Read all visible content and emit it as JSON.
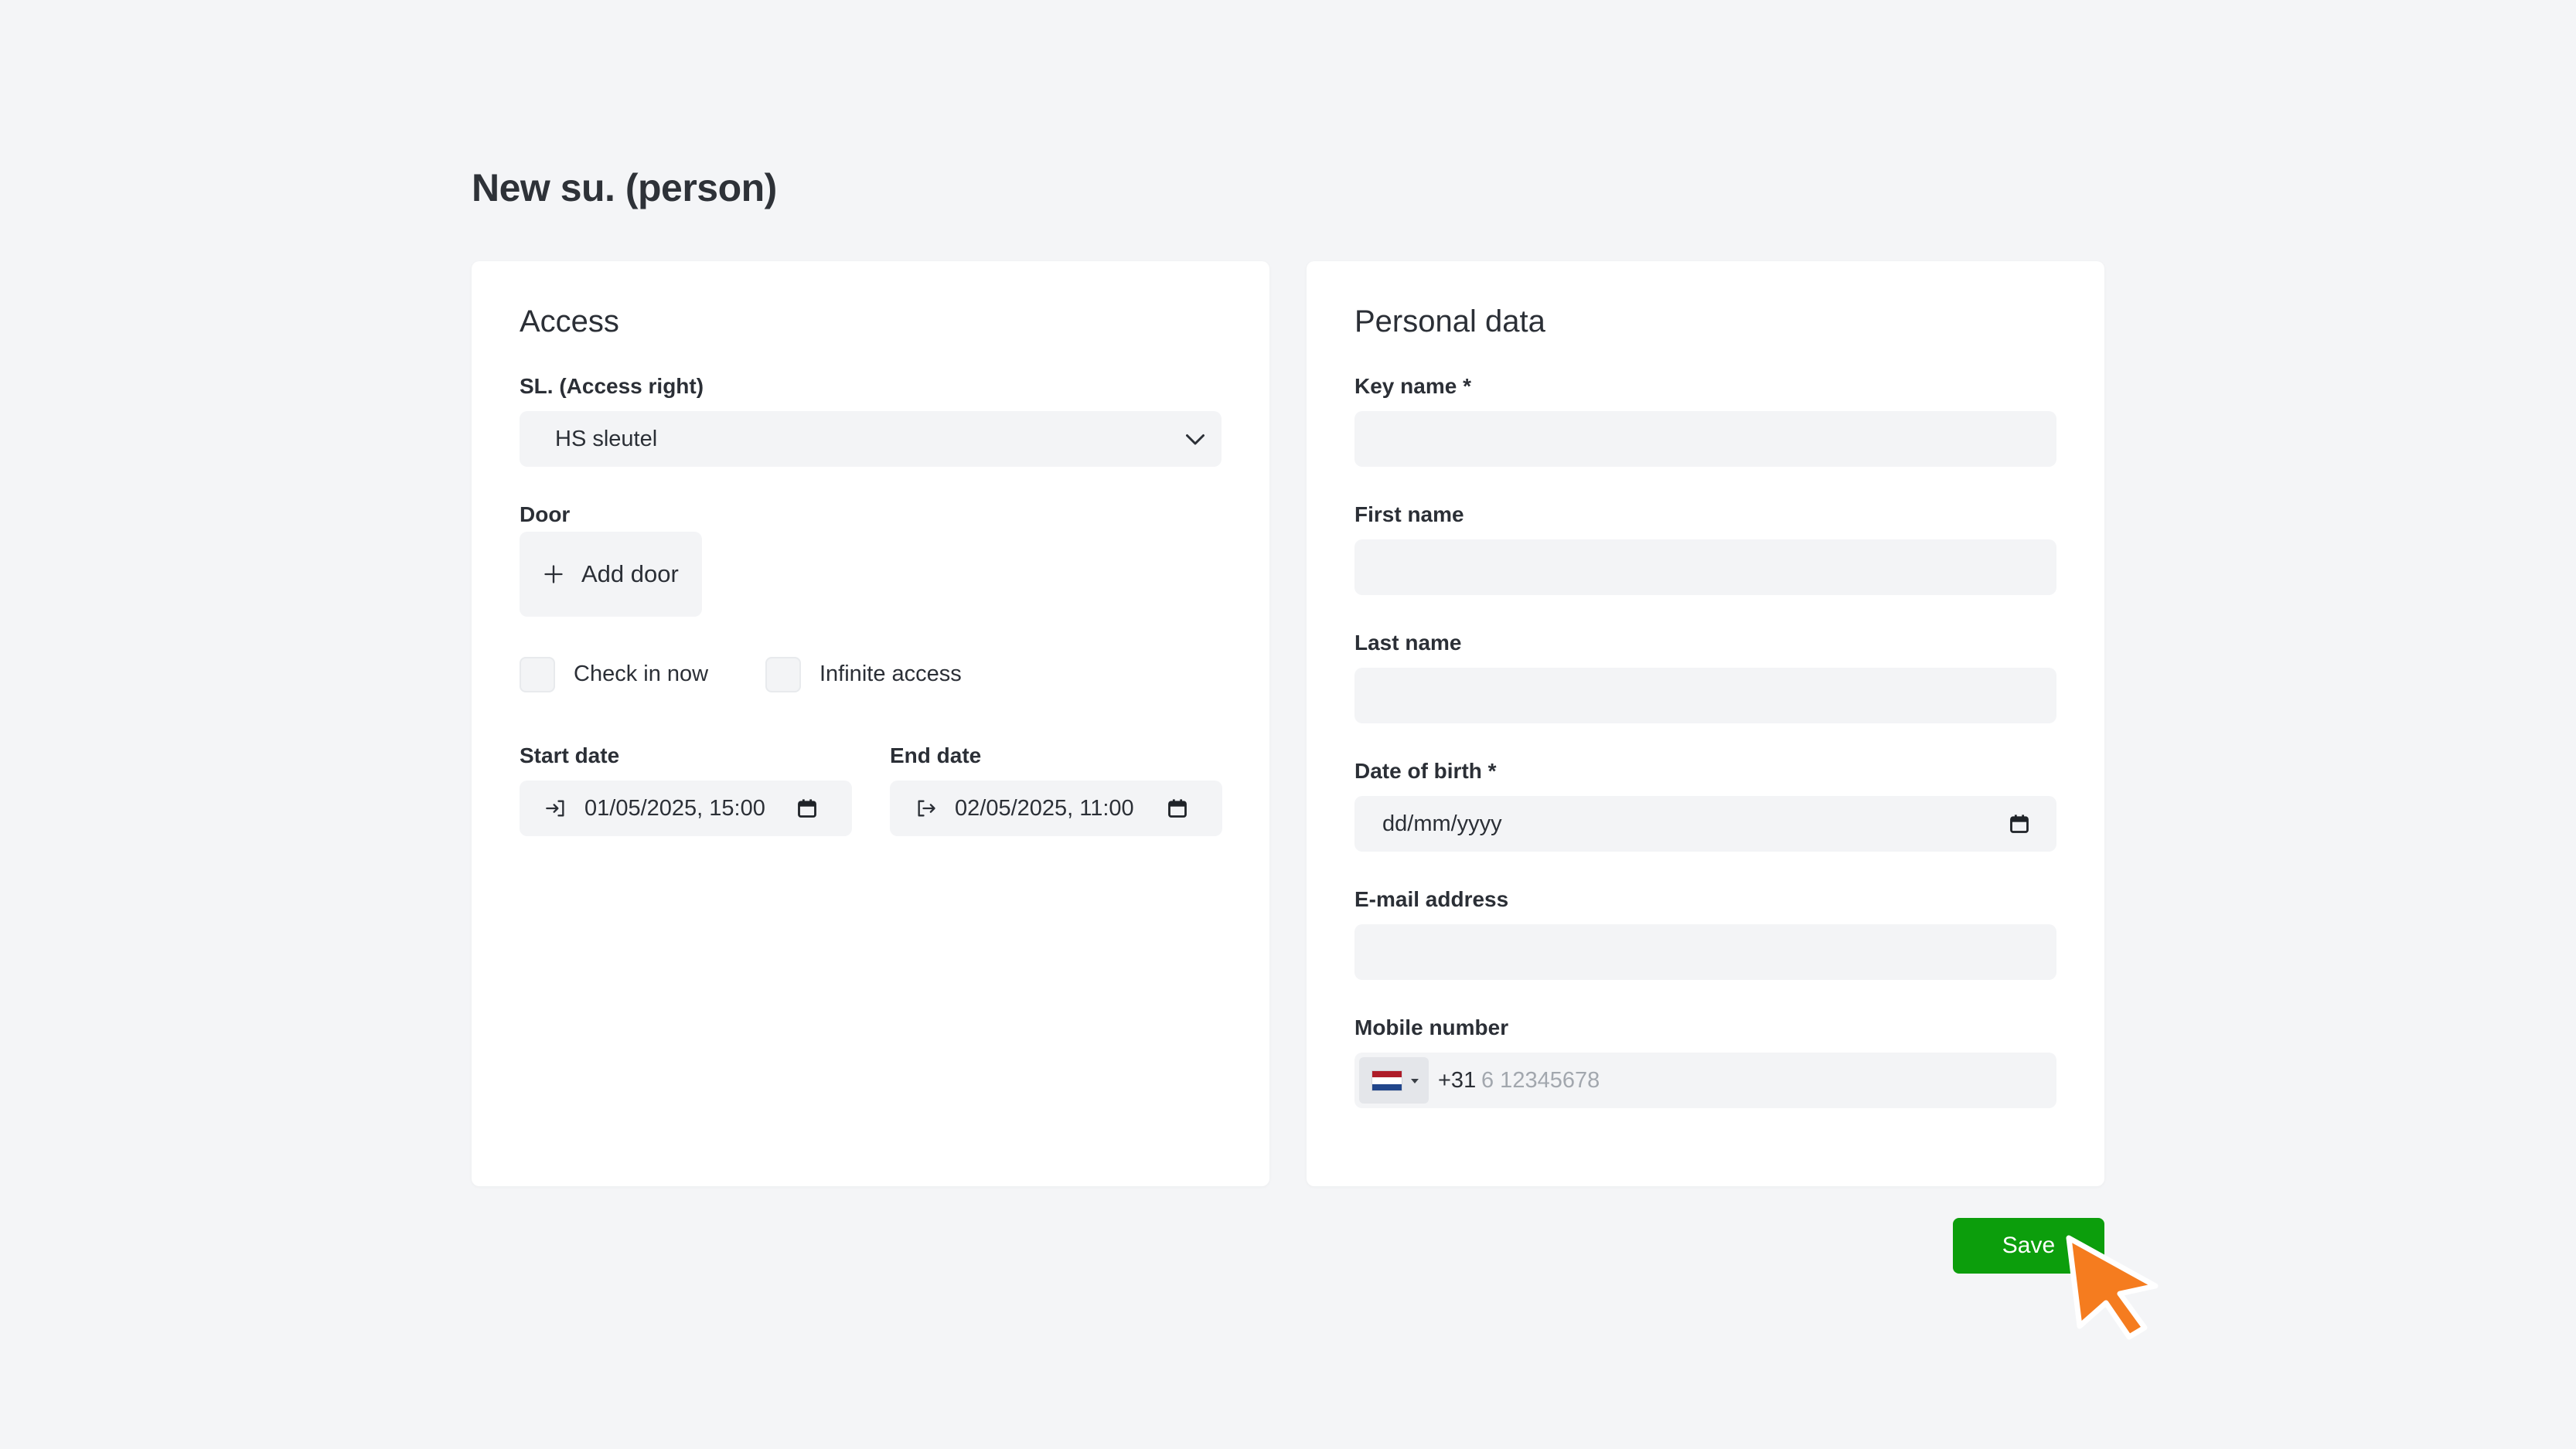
{
  "page": {
    "title": "New su. (person)"
  },
  "access": {
    "heading": "Access",
    "access_right": {
      "label": "SL. (Access right)",
      "value": "HS sleutel"
    },
    "door": {
      "label": "Door",
      "add_button": "Add door"
    },
    "check_in_now": {
      "label": "Check in now",
      "checked": false
    },
    "infinite_access": {
      "label": "Infinite access",
      "checked": false
    },
    "start_date": {
      "label": "Start date",
      "value": "01/05/2025, 15:00"
    },
    "end_date": {
      "label": "End date",
      "value": "02/05/2025, 11:00"
    }
  },
  "personal": {
    "heading": "Personal data",
    "key_name": {
      "label": "Key name *",
      "value": ""
    },
    "first_name": {
      "label": "First name",
      "value": ""
    },
    "last_name": {
      "label": "Last name",
      "value": ""
    },
    "date_of_birth": {
      "label": "Date of birth *",
      "value": "dd/mm/yyyy"
    },
    "email": {
      "label": "E-mail address",
      "value": ""
    },
    "mobile": {
      "label": "Mobile number",
      "country_code": "+31",
      "placeholder": "6 12345678",
      "value": ""
    }
  },
  "actions": {
    "save_label": "Save"
  },
  "colors": {
    "accent": "#0c9e0c",
    "cursor": "#f57c1f",
    "field_bg": "#f3f4f6"
  },
  "icons": {
    "select_caret": "chevron-down-icon",
    "add": "plus-icon",
    "start": "sign-in-icon",
    "end": "sign-out-icon",
    "calendar": "calendar-icon",
    "flag": "netherlands-flag-icon"
  }
}
